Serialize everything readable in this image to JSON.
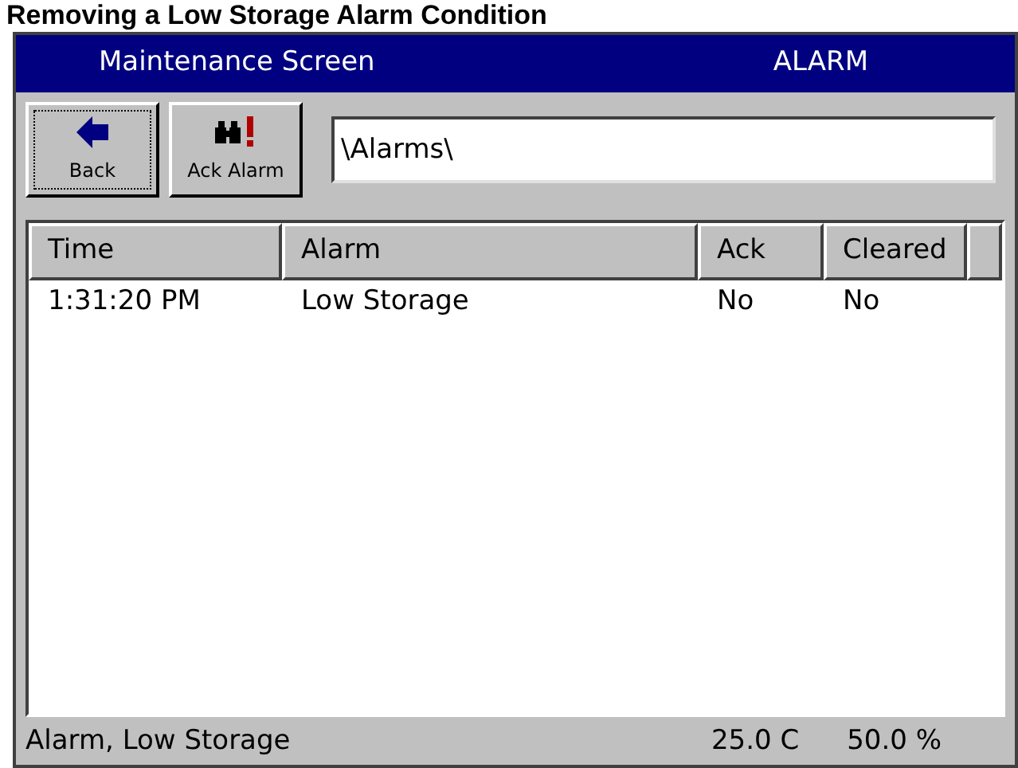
{
  "heading": "Removing a Low Storage Alarm Condition",
  "window": {
    "title": "Maintenance Screen",
    "mode": "ALARM"
  },
  "toolbar": {
    "buttons": [
      {
        "label": "Back",
        "kind": "back",
        "focused": true
      },
      {
        "label": "Ack Alarm",
        "kind": "ack",
        "focused": false
      }
    ],
    "path": "\\Alarms\\"
  },
  "table": {
    "columns": [
      "Time",
      "Alarm",
      "Ack",
      "Cleared"
    ],
    "rows": [
      [
        "1:31:20 PM",
        "Low Storage",
        "No",
        "No"
      ]
    ]
  },
  "status_bar": {
    "message": "Alarm, Low Storage",
    "temperature": "25.0 C",
    "humidity": "50.0 %"
  }
}
